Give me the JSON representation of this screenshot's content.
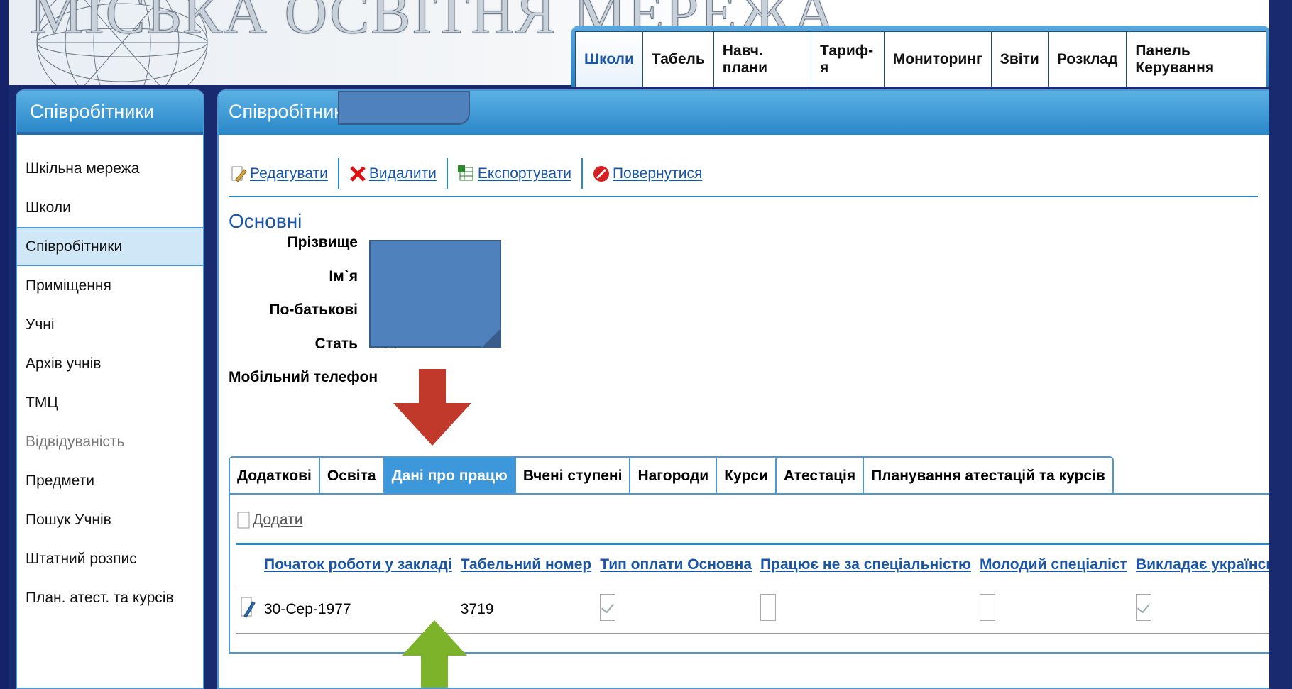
{
  "banner": {
    "title": "МІСЬКА ОСВІТНЯ МЕРЕЖА"
  },
  "nav": {
    "tabs": [
      "Школи",
      "Табель",
      "Навч. плани",
      "Тариф-я",
      "Мониторинг",
      "Звіти",
      "Розклад",
      "Панель Керування"
    ],
    "active": "Школи"
  },
  "sidebar": {
    "title": "Співробітники",
    "items": [
      {
        "label": "Шкільна мережа"
      },
      {
        "label": "Школи"
      },
      {
        "label": "Співробітники",
        "active": true
      },
      {
        "label": "Приміщення"
      },
      {
        "label": "Учні"
      },
      {
        "label": "Архів учнів"
      },
      {
        "label": "ТМЦ"
      },
      {
        "label": "Відвідуваність",
        "muted": true
      },
      {
        "label": "Предмети"
      },
      {
        "label": "Пошук Учнів"
      },
      {
        "label": "Штатний розпис"
      },
      {
        "label": "План. атест. та курсів"
      }
    ]
  },
  "main": {
    "title": "Співробітник:",
    "toolbar": {
      "edit": "Редагувати",
      "delete": "Видалити",
      "export": "Експортувати",
      "back": "Повернутися"
    },
    "section_title": "Основні",
    "fields": {
      "surname_label": "Прізвище",
      "name_label": "Ім`я",
      "patronymic_label": "По-батькові",
      "gender_label": "Стать",
      "gender_value": "Жін",
      "mobile_label": "Мобільний телефон"
    },
    "subtabs": [
      "Додаткові",
      "Освіта",
      "Дані про працю",
      "Вчені ступені",
      "Нагороди",
      "Курси",
      "Атестація",
      "Планування атестацій та курсів"
    ],
    "active_subtab": "Дані про працю",
    "add_label": "Додати",
    "table": {
      "columns": [
        "Початок роботи у закладі",
        "Табельний номер",
        "Тип оплати Основна",
        "Працює не за спеціальністю",
        "Молодий спеціаліст",
        "Викладає українською"
      ],
      "rows": [
        {
          "start": "30-Сер-1977",
          "tab_number": "3719",
          "pay_main": true,
          "not_specialty": false,
          "young_specialist": false,
          "teaches_ukrainian": true
        }
      ]
    }
  },
  "colors": {
    "accent": "#2b87c8",
    "link": "#1a56a8",
    "redaction": "#4f81bd",
    "arrow_red": "#c0392b",
    "arrow_green": "#7cb32a"
  }
}
